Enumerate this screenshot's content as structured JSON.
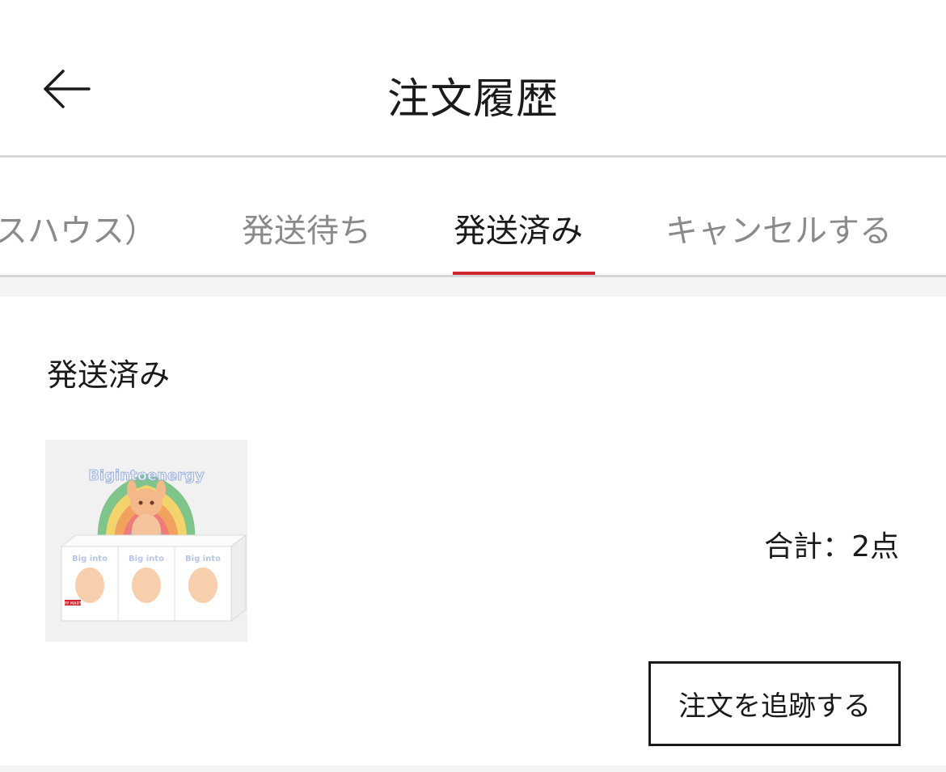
{
  "header": {
    "title": "注文履歴",
    "back_icon": "arrow-left-icon"
  },
  "tabs": [
    {
      "label": "スハウス）",
      "active": false
    },
    {
      "label": "発送待ち",
      "active": false
    },
    {
      "label": "発送済み",
      "active": true
    },
    {
      "label": "キャンセルする",
      "active": false
    }
  ],
  "colors": {
    "accent": "#d0262f",
    "inactive_tab": "#8a8a8a",
    "divider": "#d6d6d6"
  },
  "order": {
    "status": "発送済み",
    "product_image": {
      "banner_text": "Bigintoenergy",
      "box_text": "Big into",
      "label_text": "PP MART"
    },
    "total": "合計：2点",
    "track_button": "注文を追跡する"
  }
}
